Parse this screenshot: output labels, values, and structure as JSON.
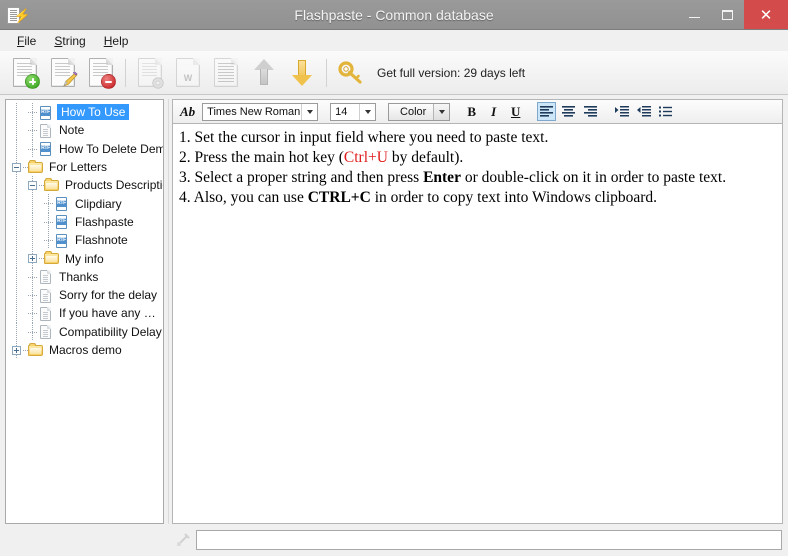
{
  "window": {
    "title": "Flashpaste - Common database",
    "app_icon": "document-lightning-icon",
    "minimize_label": "Minimize",
    "maximize_label": "Maximize",
    "close_label": "Close",
    "close_glyph": "✕"
  },
  "menubar": {
    "items": [
      {
        "label": "File",
        "mnemonic": "F",
        "rest": "ile"
      },
      {
        "label": "String",
        "mnemonic": "S",
        "rest": "tring"
      },
      {
        "label": "Help",
        "mnemonic": "H",
        "rest": "elp"
      }
    ]
  },
  "toolbar": {
    "buttons": [
      {
        "name": "new-string-button",
        "icon": "new-document-icon",
        "enabled": true
      },
      {
        "name": "edit-string-button",
        "icon": "edit-document-pencil-icon",
        "enabled": true
      },
      {
        "name": "delete-string-button",
        "icon": "delete-document-icon",
        "enabled": true
      },
      {
        "name": "string-properties-button",
        "icon": "document-gear-icon",
        "enabled": false
      },
      {
        "name": "export-word-button",
        "icon": "document-word-icon",
        "enabled": false
      },
      {
        "name": "report-button",
        "icon": "document-table-icon",
        "enabled": false
      },
      {
        "name": "move-up-button",
        "icon": "arrow-up-icon",
        "enabled": false
      },
      {
        "name": "move-down-button",
        "icon": "arrow-down-icon",
        "enabled": true
      }
    ],
    "trial": {
      "icon": "key-icon",
      "text": "Get full version: 29 days left"
    }
  },
  "tree": {
    "nodes": [
      {
        "label": "How To Use",
        "icon": "rtf-file-icon",
        "depth": 1,
        "toggle": "none",
        "selected": true
      },
      {
        "label": "Note",
        "icon": "text-file-icon",
        "depth": 1,
        "toggle": "none",
        "selected": false
      },
      {
        "label": "How To Delete Demo Text",
        "icon": "rtf-file-icon",
        "depth": 1,
        "toggle": "none",
        "selected": false
      },
      {
        "label": "For Letters",
        "icon": "folder-icon",
        "depth": 0,
        "toggle": "minus",
        "selected": false
      },
      {
        "label": "Products Description",
        "icon": "folder-icon",
        "depth": 1,
        "toggle": "minus",
        "selected": false
      },
      {
        "label": "Clipdiary",
        "icon": "rtf-file-icon",
        "depth": 2,
        "toggle": "none",
        "selected": false
      },
      {
        "label": "Flashpaste",
        "icon": "rtf-file-icon",
        "depth": 2,
        "toggle": "none",
        "selected": false
      },
      {
        "label": "Flashnote",
        "icon": "rtf-file-icon",
        "depth": 2,
        "toggle": "none",
        "selected": false
      },
      {
        "label": "My info",
        "icon": "folder-icon",
        "depth": 1,
        "toggle": "plus",
        "selected": false
      },
      {
        "label": "Thanks",
        "icon": "text-file-icon",
        "depth": 1,
        "toggle": "none",
        "selected": false
      },
      {
        "label": "Sorry for the delay",
        "icon": "text-file-icon",
        "depth": 1,
        "toggle": "none",
        "selected": false
      },
      {
        "label": "If you have any …",
        "icon": "text-file-icon",
        "depth": 1,
        "toggle": "none",
        "selected": false
      },
      {
        "label": "Compatibility Delay",
        "icon": "text-file-icon",
        "depth": 1,
        "toggle": "none",
        "selected": false
      },
      {
        "label": "Macros demo",
        "icon": "folder-icon",
        "depth": 0,
        "toggle": "plus",
        "selected": false
      }
    ]
  },
  "format_toolbar": {
    "ab_label": "Ab",
    "font": {
      "value": "Times New Roman",
      "name": "font-family-select"
    },
    "size": {
      "value": "14",
      "name": "font-size-select"
    },
    "color": {
      "value": "Color",
      "name": "font-color-select"
    },
    "bold_label": "B",
    "italic_label": "I",
    "underline_label": "U",
    "align_left": "align-left-icon",
    "align_center": "align-center-icon",
    "align_right": "align-right-icon",
    "indent_increase": "indent-increase-icon",
    "indent_decrease": "indent-decrease-icon",
    "bullet_list": "bullet-list-icon",
    "active_alignment": "left"
  },
  "editor": {
    "lines": [
      {
        "id": 1,
        "parts": [
          {
            "t": "1. Set the cursor in input field where you need to paste text.",
            "s": "n"
          }
        ]
      },
      {
        "id": 2,
        "parts": [
          {
            "t": "2. Press the main hot key (",
            "s": "n"
          },
          {
            "t": "Ctrl+U",
            "s": "red"
          },
          {
            "t": " by default).",
            "s": "n"
          }
        ]
      },
      {
        "id": 3,
        "parts": [
          {
            "t": "3. Select a proper string and then press ",
            "s": "n"
          },
          {
            "t": "Enter",
            "s": "b"
          },
          {
            "t": " or double-click on it in order to paste text.",
            "s": "n"
          }
        ]
      },
      {
        "id": 4,
        "parts": [
          {
            "t": "4. Also, you can use ",
            "s": "n"
          },
          {
            "t": "CTRL+C",
            "s": "b"
          },
          {
            "t": " in order to copy text into Windows clipboard.",
            "s": "n"
          }
        ]
      }
    ]
  },
  "bottom_bar": {
    "icon": "macro-tool-icon",
    "search_value": "",
    "search_placeholder": ""
  }
}
